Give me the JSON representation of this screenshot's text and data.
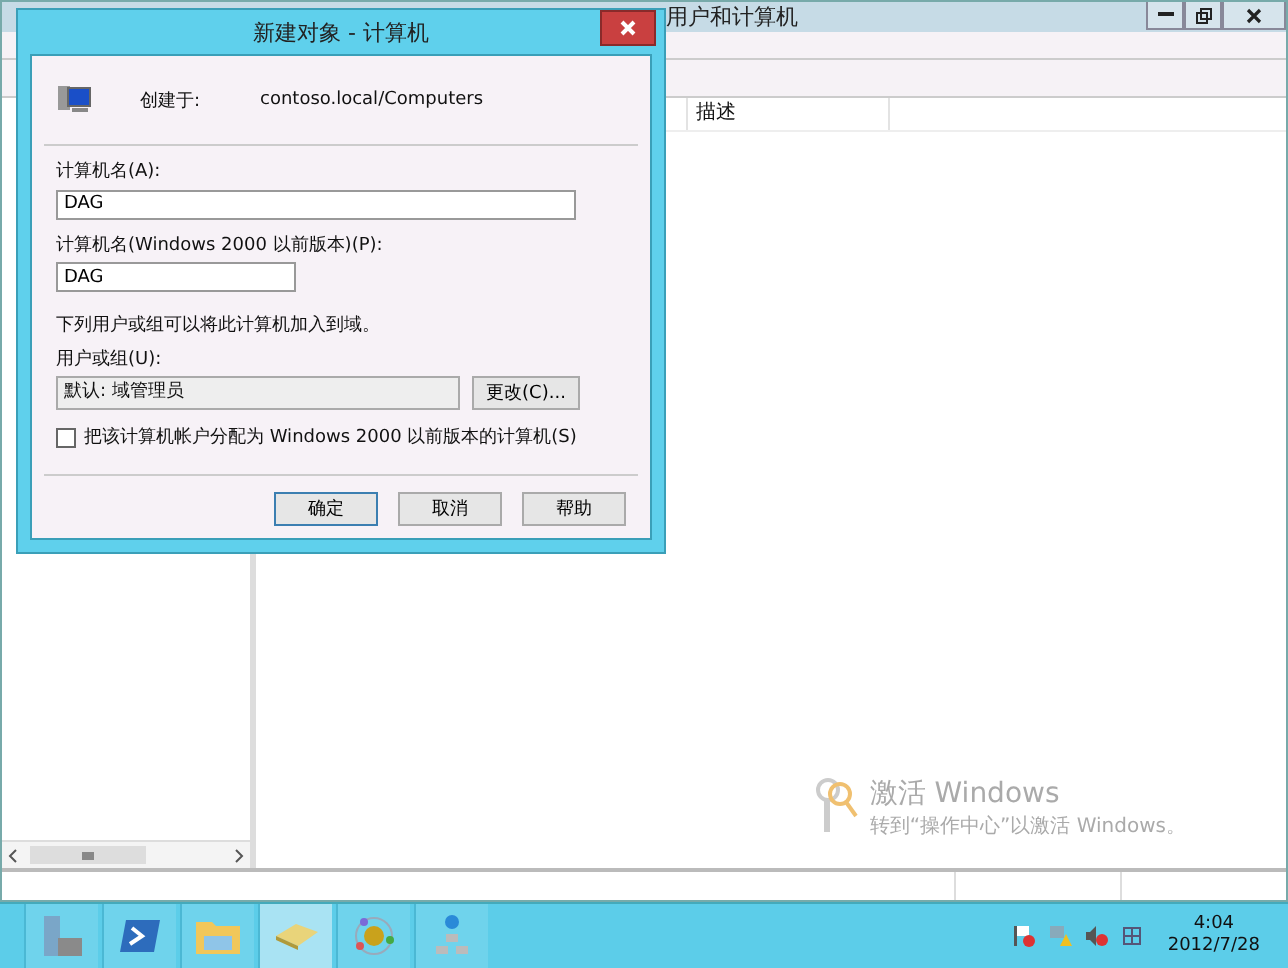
{
  "main_window": {
    "title_visible": "用户和计算机",
    "list_columns": [
      "描述"
    ]
  },
  "dialog": {
    "title": "新建对象 - 计算机",
    "created_in_label": "创建于:",
    "created_in_path": "contoso.local/Computers",
    "fields": [
      {
        "label": "计算机名(A):",
        "value": "DAG",
        "kind": "wide"
      },
      {
        "label": "计算机名(Windows 2000 以前版本)(P):",
        "value": "DAG",
        "kind": "short"
      }
    ],
    "note": "下列用户或组可以将此计算机加入到域。",
    "group_label": "用户或组(U):",
    "group_value": "默认: 域管理员",
    "change_button": "更改(C)...",
    "checkbox": {
      "label": "把该计算机帐户分配为 Windows 2000 以前版本的计算机(S)",
      "checked": false
    },
    "buttons": [
      {
        "label": "确定",
        "default": true
      },
      {
        "label": "取消",
        "default": false
      },
      {
        "label": "帮助",
        "default": false
      }
    ]
  },
  "activation": {
    "title": "激活 Windows",
    "text": "转到“操作中心”以激活 Windows。"
  },
  "taskbar": {
    "items": [
      {
        "kind": "server",
        "selected": false
      },
      {
        "kind": "terminal",
        "selected": false
      },
      {
        "kind": "folder",
        "selected": false
      },
      {
        "kind": "drawer",
        "selected": true
      },
      {
        "kind": "orbit",
        "selected": false
      },
      {
        "kind": "network",
        "selected": false
      }
    ],
    "time": "4:04",
    "date": "2012/7/28"
  }
}
